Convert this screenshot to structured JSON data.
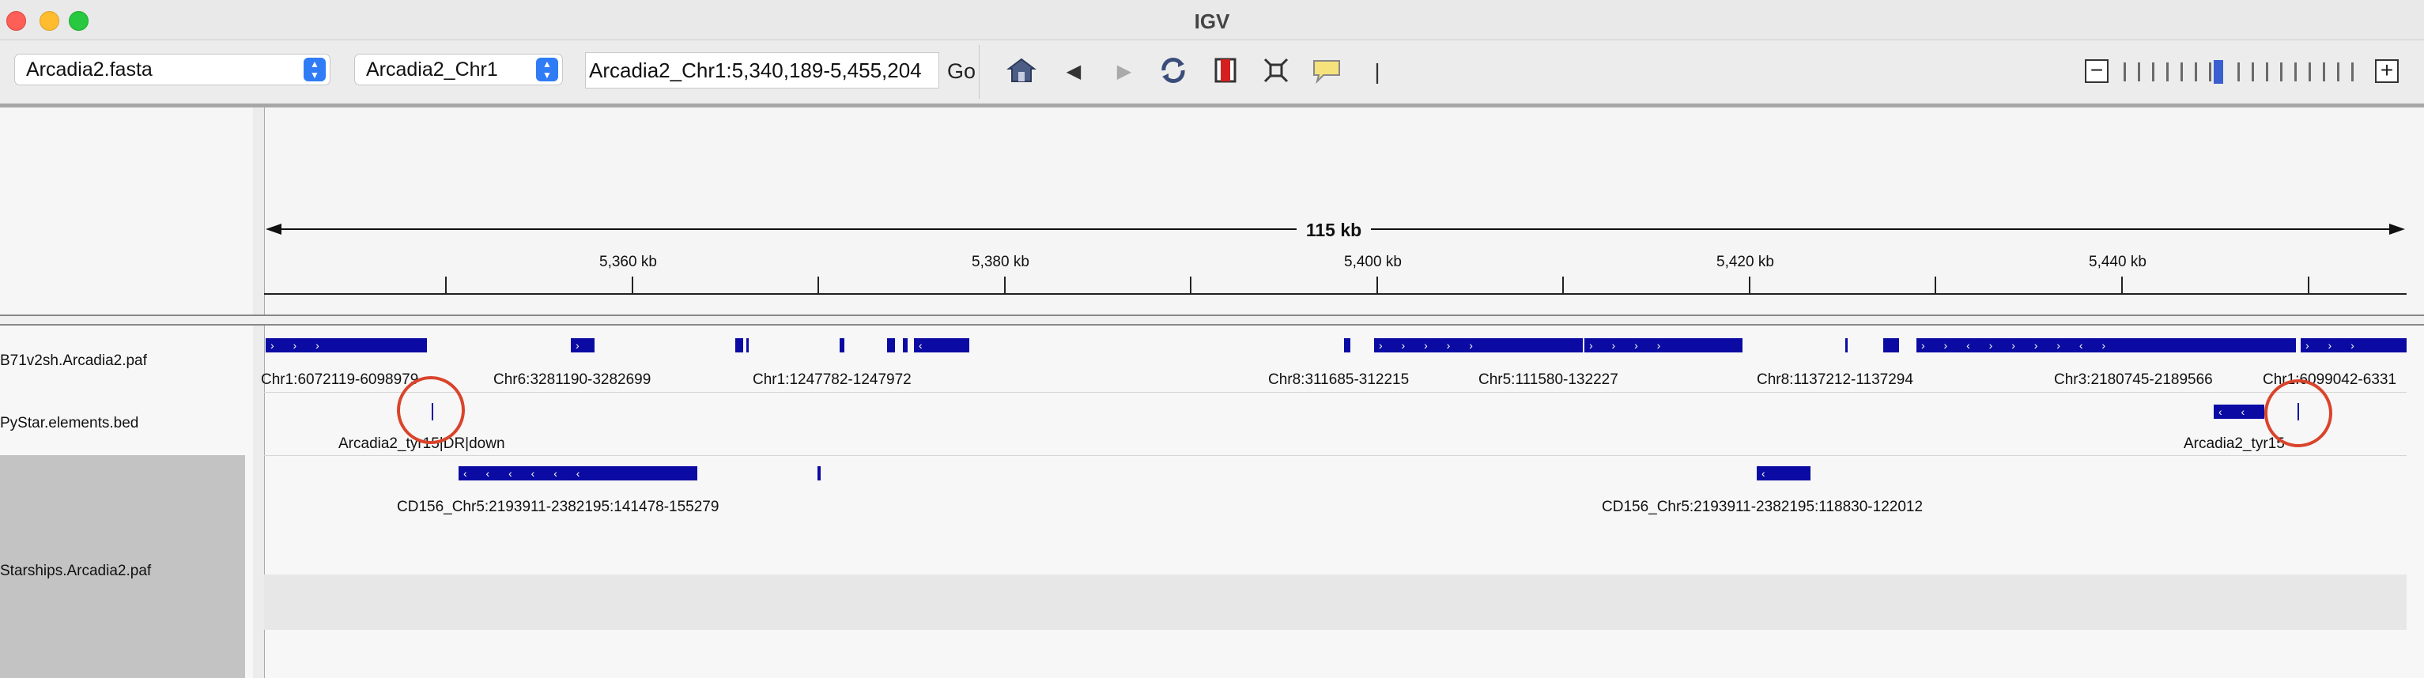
{
  "window": {
    "title": "IGV"
  },
  "toolbar": {
    "genome": "Arcadia2.fasta",
    "chromosome": "Arcadia2_Chr1",
    "locus": "Arcadia2_Chr1:5,340,189-5,455,204",
    "go_label": "Go",
    "icons": [
      "home-icon",
      "back-icon",
      "forward-icon",
      "refresh-icon",
      "roi-icon",
      "fit-icon",
      "popup-icon",
      "divider-icon"
    ]
  },
  "ruler": {
    "span": "115 kb",
    "ticks": [
      "5,360 kb",
      "5,380 kb",
      "5,400 kb",
      "5,420 kb",
      "5,440 kb"
    ]
  },
  "tracks": {
    "names": [
      "B71v2sh.Arcadia2.paf",
      "PyStar.elements.bed",
      "Starships.Arcadia2.paf"
    ],
    "paf_labels": [
      "Chr1:6072119-6098979",
      "Chr6:3281190-3282699",
      "Chr1:1247782-1247972",
      "Chr8:311685-312215",
      "Chr5:111580-132227",
      "Chr8:1137212-1137294",
      "Chr3:2180745-2189566",
      "Chr1:6099042-6331"
    ],
    "bed_labels": [
      "Arcadia2_tyr15|DR|down",
      "Arcadia2_tyr15"
    ],
    "starship_labels": [
      "CD156_Chr5:2193911-2382195:141478-155279",
      "CD156_Chr5:2193911-2382195:118830-122012"
    ]
  },
  "colors": {
    "feature": "#0b0ba3",
    "highlight_circle": "#d9442b",
    "zoom_current": "#3a5fd0"
  }
}
